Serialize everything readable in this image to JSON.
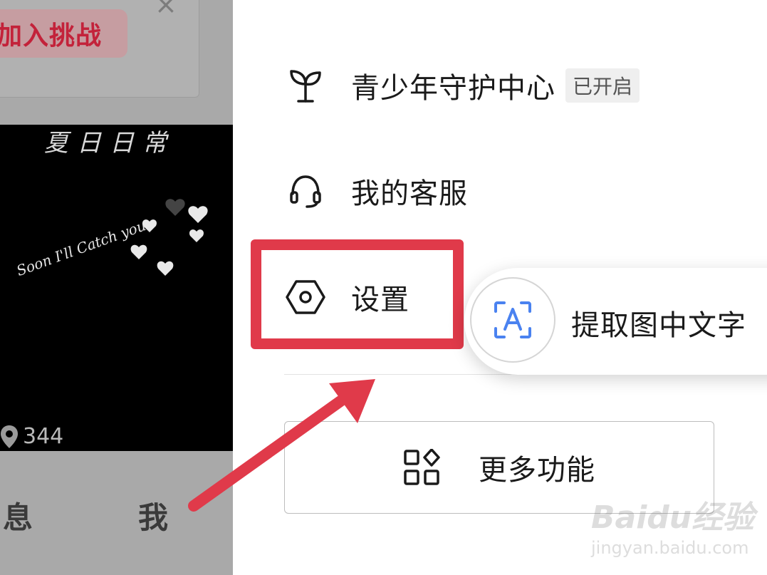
{
  "left": {
    "challenge_button": "加入挑战",
    "close_symbol": "×",
    "thumb_title": "夏日日常",
    "thumb_script": "Soon I'll Catch you.",
    "views": "344",
    "tab_messages": "息",
    "tab_me": "我"
  },
  "menu": {
    "items": [
      {
        "label": "青少年守护中心",
        "badge": "已开启",
        "icon": "sprout-icon"
      },
      {
        "label": "我的客服",
        "icon": "headset-icon"
      },
      {
        "label": "设置",
        "icon": "hexagon-settings-icon"
      }
    ],
    "more_label": "更多功能",
    "more_icon": "grid-diamond-icon"
  },
  "ocr_popup": {
    "label": "提取图中文字",
    "icon": "text-recognition-icon"
  },
  "watermark": {
    "text": "Baidu经验",
    "sub": "jingyan.baidu.com"
  },
  "colors": {
    "highlight": "#e03a4a",
    "left_overlay": "#a9a9a9",
    "ocr_icon_blue": "#4a82f0"
  }
}
